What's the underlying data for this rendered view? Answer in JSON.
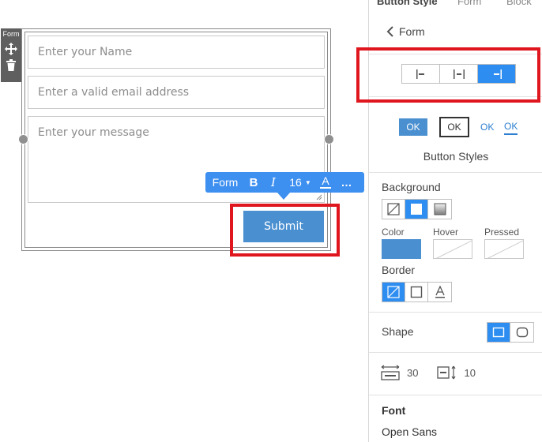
{
  "handle": {
    "label": "Form"
  },
  "form": {
    "name_placeholder": "Enter your Name",
    "email_placeholder": "Enter a valid email address",
    "message_placeholder": "Enter your message",
    "submit_label": "Submit"
  },
  "toolbar": {
    "form_label": "Form",
    "bold": "B",
    "italic": "I",
    "font_size": "16",
    "color_letter": "A",
    "more": "…"
  },
  "panel": {
    "tabs": [
      "Button Style",
      "Form",
      "Block"
    ],
    "back_label": "Form",
    "alignment": {
      "options": [
        "left",
        "center",
        "right"
      ],
      "active": "right"
    },
    "style_samples": [
      "OK",
      "OK",
      "OK",
      "OK"
    ],
    "styles_caption": "Button Styles",
    "background": {
      "label": "Background",
      "options": [
        "none",
        "solid",
        "gradient"
      ],
      "active": "solid",
      "color_label": "Color",
      "hover_label": "Hover",
      "pressed_label": "Pressed",
      "color_value": "#4a8fd0"
    },
    "border": {
      "label": "Border",
      "options": [
        "none",
        "box",
        "text-color"
      ],
      "active": "none"
    },
    "shape": {
      "label": "Shape",
      "options": [
        "square",
        "rounded"
      ],
      "active": "square"
    },
    "spacing": {
      "horizontal": "30",
      "vertical": "10"
    },
    "font": {
      "label": "Font",
      "value": "Open Sans"
    }
  },
  "colors": {
    "accent": "#2d8df0",
    "button": "#4a8fd0",
    "highlight": "#e0161e"
  }
}
